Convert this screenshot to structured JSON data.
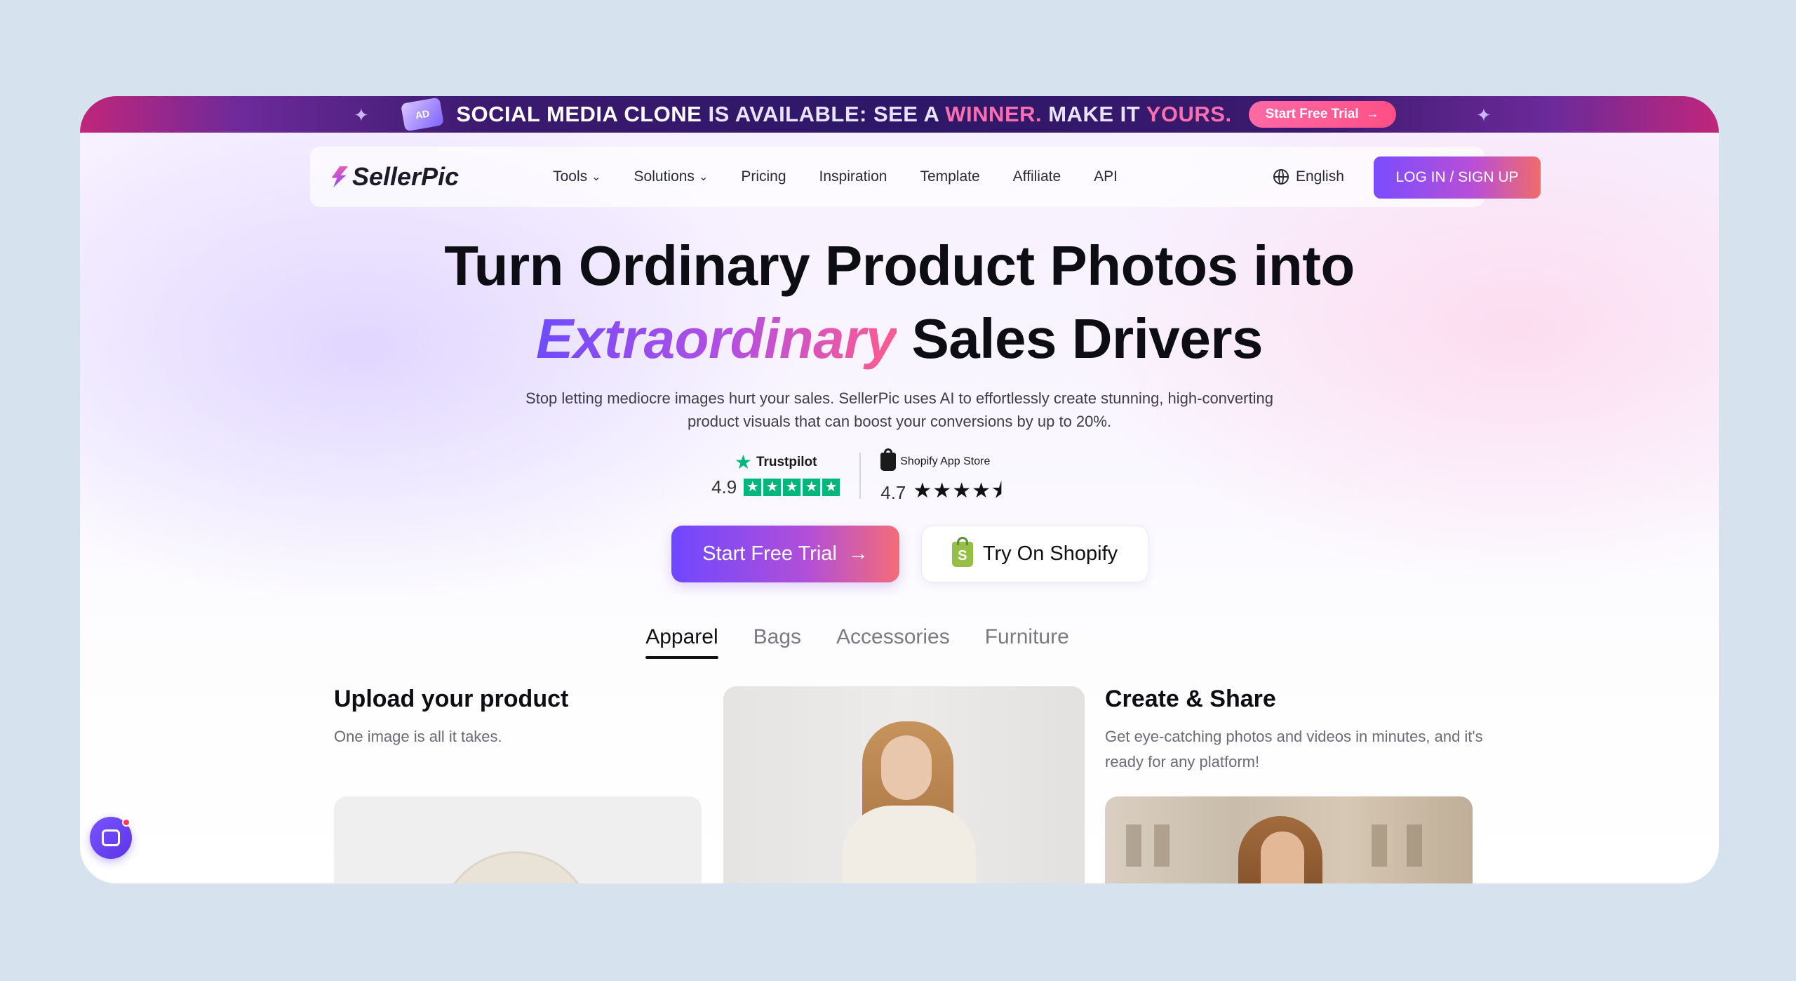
{
  "ad_banner": {
    "badge": "AD",
    "text_part1": "SOCIAL MEDIA CLONE",
    "text_part2": " IS AVAILABLE: SEE A ",
    "text_part3": "WINNER.",
    "text_part4": " MAKE IT ",
    "text_part5": "YOURS.",
    "cta_label": "Start Free Trial",
    "cta_arrow": "→"
  },
  "nav": {
    "logo_text": "SellerPic",
    "items": [
      {
        "label": "Tools",
        "has_dropdown": true
      },
      {
        "label": "Solutions",
        "has_dropdown": true
      },
      {
        "label": "Pricing",
        "has_dropdown": false
      },
      {
        "label": "Inspiration",
        "has_dropdown": false
      },
      {
        "label": "Template",
        "has_dropdown": false
      },
      {
        "label": "Affiliate",
        "has_dropdown": false
      },
      {
        "label": "API",
        "has_dropdown": false
      }
    ],
    "language": "English",
    "login_label": "LOG IN / SIGN UP"
  },
  "hero": {
    "title_line1": "Turn Ordinary Product Photos into",
    "title_highlight": "Extraordinary",
    "title_line2_rest": " Sales Drivers",
    "subtitle": "Stop letting mediocre images hurt your sales. SellerPic uses AI to effortlessly create stunning, high-converting product visuals that can boost your conversions by up to 20%."
  },
  "ratings": {
    "trustpilot": {
      "label": "Trustpilot",
      "score": "4.9",
      "stars": 5
    },
    "shopify": {
      "label": "Shopify App Store",
      "score": "4.7",
      "stars": 4.5
    }
  },
  "cta": {
    "primary_label": "Start Free Trial",
    "primary_arrow": "→",
    "secondary_label": "Try On Shopify"
  },
  "tabs": [
    {
      "label": "Apparel",
      "active": true
    },
    {
      "label": "Bags",
      "active": false
    },
    {
      "label": "Accessories",
      "active": false
    },
    {
      "label": "Furniture",
      "active": false
    }
  ],
  "steps": {
    "upload_title": "Upload your product",
    "upload_desc": "One image is all it takes.",
    "share_title": "Create & Share",
    "share_desc": "Get eye-catching photos and videos in minutes, and it's ready for any platform!"
  },
  "colors": {
    "brand_purple": "#6e48ff",
    "brand_pink": "#f46c78",
    "trustpilot_green": "#00b67a",
    "shopify_green": "#95bf47"
  }
}
